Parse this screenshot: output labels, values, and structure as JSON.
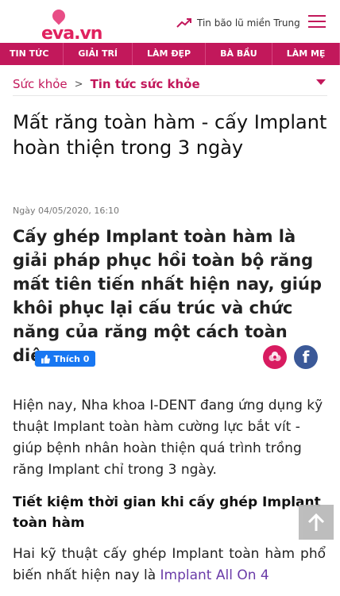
{
  "header": {
    "logo_text": "eva.vn",
    "breaking_news": "Tin bão lũ miền Trung",
    "icons": {
      "trend": "trending-up-icon",
      "menu": "hamburger-icon"
    }
  },
  "nav": {
    "items": [
      "TIN TỨC",
      "GIẢI TRÍ",
      "LÀM ĐẸP",
      "BÀ BẦU",
      "LÀM MẸ"
    ]
  },
  "breadcrumb": {
    "home": "Sức khỏe",
    "separator": ">",
    "current": "Tin tức sức khỏe"
  },
  "article": {
    "title": "Mất răng toàn hàm - cấy Implant hoàn thiện trong 3 ngày",
    "date": "Ngày 04/05/2020, 16:10",
    "lead": "Cấy ghép Implant toàn hàm là giải pháp phục hồi toàn bộ răng mất tiên tiến nhất hiện nay, giúp khôi phục lại cấu trúc và chức năng của răng một cách toàn diện.",
    "paragraph1": "Hiện nay, Nha khoa I-DENT đang ứng dụng kỹ thuật Implant toàn hàm cường lực bắt vít - giúp bệnh nhân hoàn thiện quá trình trồng răng Implant chỉ trong 3 ngày.",
    "heading2": "Tiết kiệm thời gian khi cấy ghép Implant toàn hàm",
    "paragraph2_start": "Hai kỹ thuật cấy ghép Implant toàn hàm phổ biến nhất hiện nay là ",
    "paragraph2_link": "Implant All On 4"
  },
  "social": {
    "like_label": "Thích 0"
  },
  "colors": {
    "brand": "#c2185b",
    "facebook": "#3b5998",
    "like": "#1877f2",
    "link": "#6a3ba8"
  }
}
